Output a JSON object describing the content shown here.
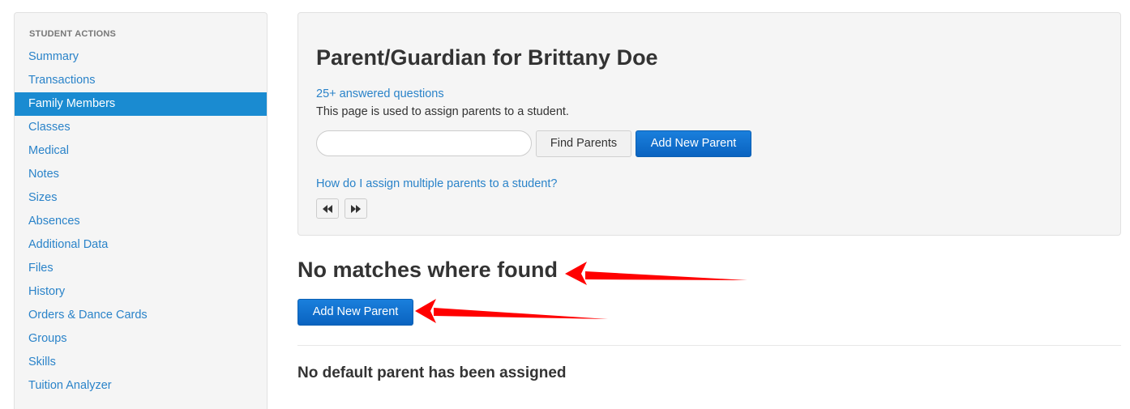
{
  "sidebar": {
    "heading": "STUDENT ACTIONS",
    "items": [
      {
        "label": "Summary"
      },
      {
        "label": "Transactions"
      },
      {
        "label": "Family Members",
        "active": true
      },
      {
        "label": "Classes"
      },
      {
        "label": "Medical"
      },
      {
        "label": "Notes"
      },
      {
        "label": "Sizes"
      },
      {
        "label": "Absences"
      },
      {
        "label": "Additional Data"
      },
      {
        "label": "Files"
      },
      {
        "label": "History"
      },
      {
        "label": "Orders & Dance Cards"
      },
      {
        "label": "Groups"
      },
      {
        "label": "Skills"
      },
      {
        "label": "Tuition Analyzer"
      }
    ]
  },
  "panel": {
    "title": "Parent/Guardian for Brittany Doe",
    "faq_link": "25+ answered questions",
    "description": "This page is used to assign parents to a student.",
    "search": {
      "value": "",
      "placeholder": ""
    },
    "find_button": "Find Parents",
    "add_button": "Add New Parent",
    "help_link": "How do I assign multiple parents to a student?",
    "nav": {
      "prev_icon": "rewind-icon",
      "next_icon": "fast-forward-icon"
    }
  },
  "results": {
    "heading": "No matches where found",
    "add_button": "Add New Parent"
  },
  "default_parent": {
    "message": "No default parent has been assigned"
  },
  "colors": {
    "link": "#2a83c9",
    "active_bg": "#1a8bd1",
    "primary_button": "#0a6fd0",
    "annotation_arrow": "#ff0000"
  }
}
